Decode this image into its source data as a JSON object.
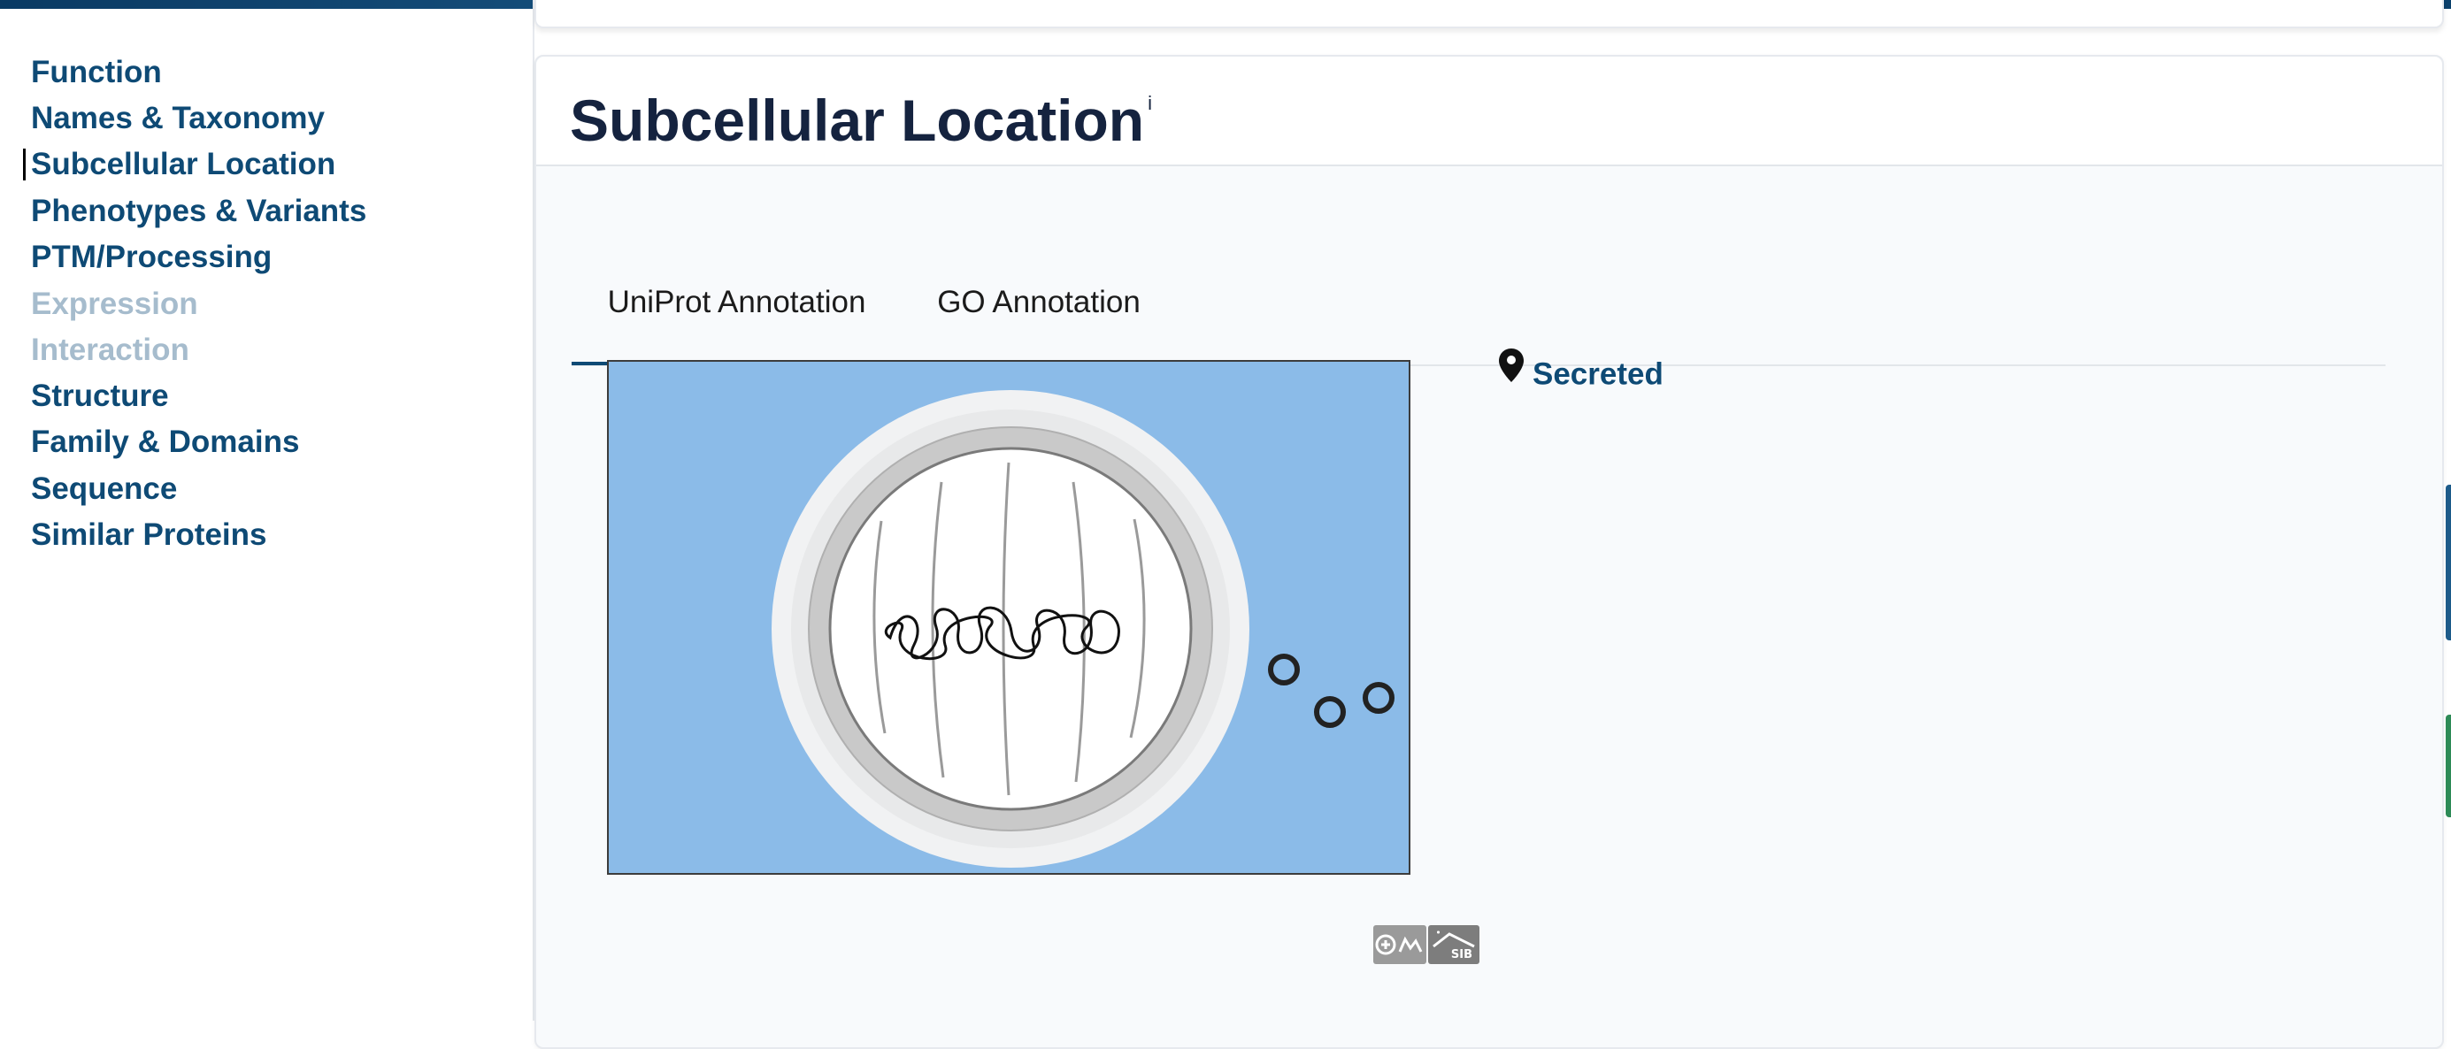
{
  "sidebar": {
    "items": [
      {
        "label": "Function",
        "state": "normal"
      },
      {
        "label": "Names & Taxonomy",
        "state": "normal"
      },
      {
        "label": "Subcellular Location",
        "state": "active"
      },
      {
        "label": "Phenotypes & Variants",
        "state": "normal"
      },
      {
        "label": "PTM/Processing",
        "state": "normal"
      },
      {
        "label": "Expression",
        "state": "disabled"
      },
      {
        "label": "Interaction",
        "state": "disabled"
      },
      {
        "label": "Structure",
        "state": "normal"
      },
      {
        "label": "Family & Domains",
        "state": "normal"
      },
      {
        "label": "Sequence",
        "state": "normal"
      },
      {
        "label": "Similar Proteins",
        "state": "normal"
      }
    ]
  },
  "section": {
    "title": "Subcellular Location",
    "info_marker": "i"
  },
  "tabs": [
    {
      "label": "UniProt Annotation",
      "selected": true
    },
    {
      "label": "GO Annotation",
      "selected": false
    }
  ],
  "annotation": {
    "location_icon": "map-marker-icon",
    "location_label": "Secreted"
  },
  "figure": {
    "background_color": "#8bbbe8",
    "depicts": "cell-diagram-with-secreted-vesicles"
  },
  "logos": [
    "sib-swissprot-logo",
    "sib-logo"
  ],
  "logo_text": "SIB",
  "colors": {
    "brand": "#0e4a75",
    "disabled": "#a6bccd",
    "title": "#15233f"
  }
}
